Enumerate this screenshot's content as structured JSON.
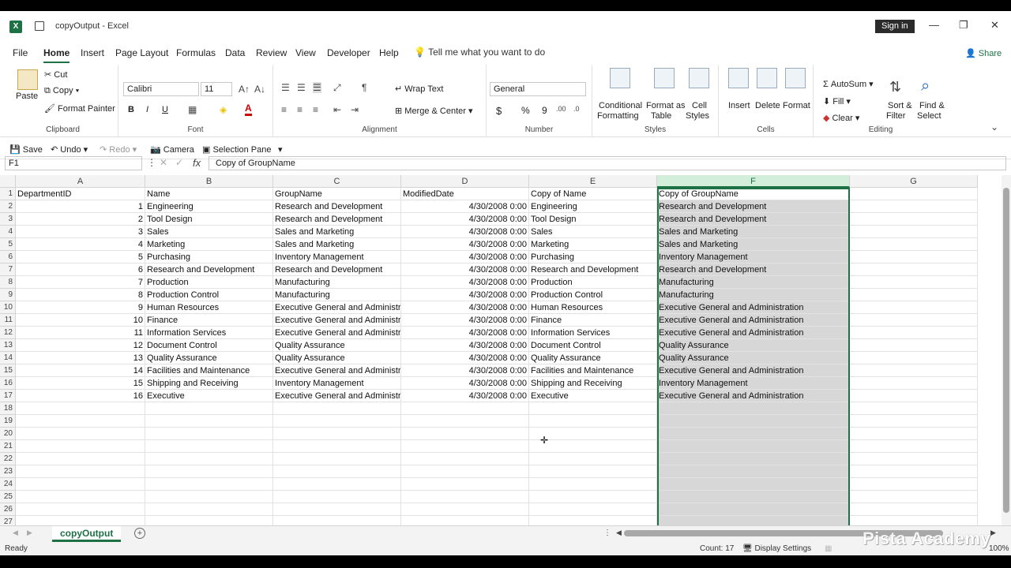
{
  "window": {
    "title": "copyOutput  -  Excel",
    "sign_in": "Sign in"
  },
  "menu": [
    "File",
    "Home",
    "Insert",
    "Page Layout",
    "Formulas",
    "Data",
    "Review",
    "View",
    "Developer",
    "Help"
  ],
  "tell_me": "Tell me what you want to do",
  "share": "Share",
  "ribbon": {
    "clipboard": {
      "paste": "Paste",
      "cut": "Cut",
      "copy": "Copy",
      "format_painter": "Format Painter",
      "label": "Clipboard"
    },
    "font": {
      "name": "Calibri",
      "size": "11",
      "bold": "B",
      "italic": "I",
      "underline": "U",
      "label": "Font"
    },
    "alignment": {
      "wrap": "Wrap Text",
      "merge": "Merge & Center",
      "label": "Alignment"
    },
    "number": {
      "format": "General",
      "currency": "$",
      "percent": "%",
      "comma": "9",
      "label": "Number"
    },
    "styles": {
      "conditional": "Conditional",
      "conditional2": "Formatting",
      "format_as": "Format as",
      "format_as2": "Table",
      "cell": "Cell",
      "cell2": "Styles",
      "label": "Styles"
    },
    "cells": {
      "insert": "Insert",
      "delete": "Delete",
      "format": "Format",
      "label": "Cells"
    },
    "editing": {
      "autosum": "AutoSum",
      "fill": "Fill",
      "clear": "Clear",
      "sort": "Sort &",
      "sort2": "Filter",
      "find": "Find &",
      "find2": "Select",
      "label": "Editing"
    }
  },
  "qat": {
    "save": "Save",
    "undo": "Undo",
    "redo": "Redo",
    "camera": "Camera",
    "selection": "Selection Pane"
  },
  "formula_bar": {
    "name_box": "F1",
    "fx": "fx",
    "formula": "Copy of GroupName"
  },
  "columns": [
    "A",
    "B",
    "C",
    "D",
    "E",
    "F",
    "G"
  ],
  "headers": [
    "DepartmentID",
    "Name",
    "GroupName",
    "ModifiedDate",
    "Copy of Name",
    "Copy of GroupName"
  ],
  "rows": [
    [
      "1",
      "Engineering",
      "Research and Development",
      "4/30/2008 0:00",
      "Engineering",
      "Research and Development"
    ],
    [
      "2",
      "Tool Design",
      "Research and Development",
      "4/30/2008 0:00",
      "Tool Design",
      "Research and Development"
    ],
    [
      "3",
      "Sales",
      "Sales and Marketing",
      "4/30/2008 0:00",
      "Sales",
      "Sales and Marketing"
    ],
    [
      "4",
      "Marketing",
      "Sales and Marketing",
      "4/30/2008 0:00",
      "Marketing",
      "Sales and Marketing"
    ],
    [
      "5",
      "Purchasing",
      "Inventory Management",
      "4/30/2008 0:00",
      "Purchasing",
      "Inventory Management"
    ],
    [
      "6",
      "Research and Development",
      "Research and Development",
      "4/30/2008 0:00",
      "Research and Development",
      "Research and Development"
    ],
    [
      "7",
      "Production",
      "Manufacturing",
      "4/30/2008 0:00",
      "Production",
      "Manufacturing"
    ],
    [
      "8",
      "Production Control",
      "Manufacturing",
      "4/30/2008 0:00",
      "Production Control",
      "Manufacturing"
    ],
    [
      "9",
      "Human Resources",
      "Executive General and Administra",
      "4/30/2008 0:00",
      "Human Resources",
      "Executive General and Administration"
    ],
    [
      "10",
      "Finance",
      "Executive General and Administra",
      "4/30/2008 0:00",
      "Finance",
      "Executive General and Administration"
    ],
    [
      "11",
      "Information Services",
      "Executive General and Administra",
      "4/30/2008 0:00",
      "Information Services",
      "Executive General and Administration"
    ],
    [
      "12",
      "Document Control",
      "Quality Assurance",
      "4/30/2008 0:00",
      "Document Control",
      "Quality Assurance"
    ],
    [
      "13",
      "Quality Assurance",
      "Quality Assurance",
      "4/30/2008 0:00",
      "Quality Assurance",
      "Quality Assurance"
    ],
    [
      "14",
      "Facilities and Maintenance",
      "Executive General and Administra",
      "4/30/2008 0:00",
      "Facilities and Maintenance",
      "Executive General and Administration"
    ],
    [
      "15",
      "Shipping and Receiving",
      "Inventory Management",
      "4/30/2008 0:00",
      "Shipping and Receiving",
      "Inventory Management"
    ],
    [
      "16",
      "Executive",
      "Executive General and Administra",
      "4/30/2008 0:00",
      "Executive",
      "Executive General and Administration"
    ]
  ],
  "row_numbers": [
    "1",
    "2",
    "3",
    "4",
    "5",
    "6",
    "7",
    "8",
    "9",
    "10",
    "11",
    "12",
    "13",
    "14",
    "15",
    "16",
    "17",
    "18",
    "19",
    "20",
    "21",
    "22",
    "23",
    "24",
    "25",
    "26",
    "27"
  ],
  "sheet_tab": "copyOutput",
  "status": {
    "ready": "Ready",
    "count": "Count: 17",
    "display": "Display Settings",
    "zoom": "100%"
  },
  "watermark": "Pista Academy",
  "colors": {
    "accent": "#1e7145",
    "selection": "#d7d7d7"
  }
}
